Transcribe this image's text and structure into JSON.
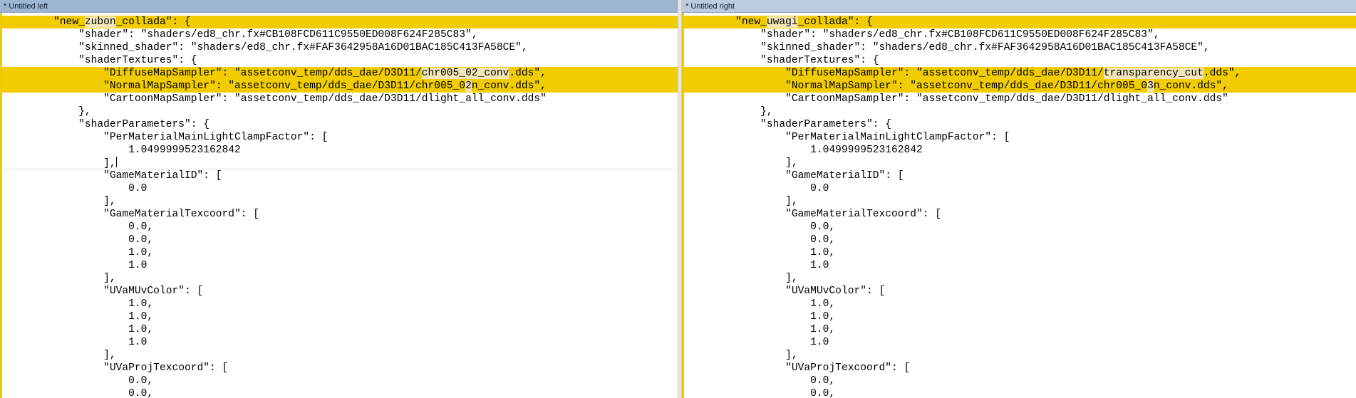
{
  "colors": {
    "changed_line": "#f0cc00",
    "changed_segment": "#f2e6b8",
    "left_titlebar": "#9fb6d3",
    "right_titlebar": "#bccbdf"
  },
  "left": {
    "title": "* Untitled left",
    "lines": [
      {
        "hl": true,
        "segs": [
          {
            "t": "        \"new_"
          },
          {
            "t": "zubon",
            "d": true
          },
          {
            "t": "_collada\": {"
          }
        ]
      },
      {
        "segs": [
          {
            "t": "            \"shader\": \"shaders/ed8_chr.fx#CB108FCD611C9550ED008F624F285C83\","
          }
        ]
      },
      {
        "segs": [
          {
            "t": "            \"skinned_shader\": \"shaders/ed8_chr.fx#FAF3642958A16D01BAC185C413FA58CE\","
          }
        ]
      },
      {
        "segs": [
          {
            "t": "            \"shaderTextures\": {"
          }
        ]
      },
      {
        "hl": true,
        "segs": [
          {
            "t": "                \"DiffuseMapSampler\": \"assetconv_temp/dds_dae/D3D11/"
          },
          {
            "t": "chr005_02_conv",
            "d": true
          },
          {
            "t": ".dds\","
          }
        ]
      },
      {
        "hl": true,
        "segs": [
          {
            "t": "                \"NormalMapSampler\": \"assetconv_temp/dds_dae/D3D11/chr005_0"
          },
          {
            "t": "2",
            "d": true
          },
          {
            "t": "n_conv.dds\","
          }
        ]
      },
      {
        "segs": [
          {
            "t": "                \"CartoonMapSampler\": \"assetconv_temp/dds_dae/D3D11/dlight_all_conv.dds\""
          }
        ]
      },
      {
        "segs": [
          {
            "t": "            },"
          }
        ]
      },
      {
        "segs": [
          {
            "t": "            \"shaderParameters\": {"
          }
        ]
      },
      {
        "segs": [
          {
            "t": "                \"PerMaterialMainLightClampFactor\": ["
          }
        ]
      },
      {
        "segs": [
          {
            "t": "                    1.0499999523162842"
          }
        ]
      },
      {
        "sep": true,
        "caret": true,
        "segs": [
          {
            "t": "                ],"
          }
        ]
      },
      {
        "segs": [
          {
            "t": "                \"GameMaterialID\": ["
          }
        ]
      },
      {
        "segs": [
          {
            "t": "                    0.0"
          }
        ]
      },
      {
        "segs": [
          {
            "t": "                ],"
          }
        ]
      },
      {
        "segs": [
          {
            "t": "                \"GameMaterialTexcoord\": ["
          }
        ]
      },
      {
        "segs": [
          {
            "t": "                    0.0,"
          }
        ]
      },
      {
        "segs": [
          {
            "t": "                    0.0,"
          }
        ]
      },
      {
        "segs": [
          {
            "t": "                    1.0,"
          }
        ]
      },
      {
        "segs": [
          {
            "t": "                    1.0"
          }
        ]
      },
      {
        "segs": [
          {
            "t": "                ],"
          }
        ]
      },
      {
        "segs": [
          {
            "t": "                \"UVaMUvColor\": ["
          }
        ]
      },
      {
        "segs": [
          {
            "t": "                    1.0,"
          }
        ]
      },
      {
        "segs": [
          {
            "t": "                    1.0,"
          }
        ]
      },
      {
        "segs": [
          {
            "t": "                    1.0,"
          }
        ]
      },
      {
        "segs": [
          {
            "t": "                    1.0"
          }
        ]
      },
      {
        "segs": [
          {
            "t": "                ],"
          }
        ]
      },
      {
        "segs": [
          {
            "t": "                \"UVaProjTexcoord\": ["
          }
        ]
      },
      {
        "segs": [
          {
            "t": "                    0.0,"
          }
        ]
      },
      {
        "segs": [
          {
            "t": "                    0.0,"
          }
        ]
      }
    ]
  },
  "right": {
    "title": "* Untitled right",
    "lines": [
      {
        "hl": true,
        "segs": [
          {
            "t": "        \"new_"
          },
          {
            "t": "uwagi",
            "d": true
          },
          {
            "t": "_collada\": {"
          }
        ]
      },
      {
        "segs": [
          {
            "t": "            \"shader\": \"shaders/ed8_chr.fx#CB108FCD611C9550ED008F624F285C83\","
          }
        ]
      },
      {
        "segs": [
          {
            "t": "            \"skinned_shader\": \"shaders/ed8_chr.fx#FAF3642958A16D01BAC185C413FA58CE\","
          }
        ]
      },
      {
        "segs": [
          {
            "t": "            \"shaderTextures\": {"
          }
        ]
      },
      {
        "hl": true,
        "segs": [
          {
            "t": "                \"DiffuseMapSampler\": \"assetconv_temp/dds_dae/D3D11/"
          },
          {
            "t": "transparency_cut",
            "d": true
          },
          {
            "t": ".dds\","
          }
        ]
      },
      {
        "hl": true,
        "segs": [
          {
            "t": "                \"NormalMapSampler\": \"assetconv_temp/dds_dae/D3D11/chr005_0"
          },
          {
            "t": "3",
            "d": true
          },
          {
            "t": "n_conv.dds\","
          }
        ]
      },
      {
        "segs": [
          {
            "t": "                \"CartoonMapSampler\": \"assetconv_temp/dds_dae/D3D11/dlight_all_conv.dds\""
          }
        ]
      },
      {
        "segs": [
          {
            "t": "            },"
          }
        ]
      },
      {
        "segs": [
          {
            "t": "            \"shaderParameters\": {"
          }
        ]
      },
      {
        "segs": [
          {
            "t": "                \"PerMaterialMainLightClampFactor\": ["
          }
        ]
      },
      {
        "segs": [
          {
            "t": "                    1.0499999523162842"
          }
        ]
      },
      {
        "segs": [
          {
            "t": "                ],"
          }
        ]
      },
      {
        "segs": [
          {
            "t": "                \"GameMaterialID\": ["
          }
        ]
      },
      {
        "segs": [
          {
            "t": "                    0.0"
          }
        ]
      },
      {
        "segs": [
          {
            "t": "                ],"
          }
        ]
      },
      {
        "segs": [
          {
            "t": "                \"GameMaterialTexcoord\": ["
          }
        ]
      },
      {
        "segs": [
          {
            "t": "                    0.0,"
          }
        ]
      },
      {
        "segs": [
          {
            "t": "                    0.0,"
          }
        ]
      },
      {
        "segs": [
          {
            "t": "                    1.0,"
          }
        ]
      },
      {
        "segs": [
          {
            "t": "                    1.0"
          }
        ]
      },
      {
        "segs": [
          {
            "t": "                ],"
          }
        ]
      },
      {
        "segs": [
          {
            "t": "                \"UVaMUvColor\": ["
          }
        ]
      },
      {
        "segs": [
          {
            "t": "                    1.0,"
          }
        ]
      },
      {
        "segs": [
          {
            "t": "                    1.0,"
          }
        ]
      },
      {
        "segs": [
          {
            "t": "                    1.0,"
          }
        ]
      },
      {
        "segs": [
          {
            "t": "                    1.0"
          }
        ]
      },
      {
        "segs": [
          {
            "t": "                ],"
          }
        ]
      },
      {
        "segs": [
          {
            "t": "                \"UVaProjTexcoord\": ["
          }
        ]
      },
      {
        "segs": [
          {
            "t": "                    0.0,"
          }
        ]
      },
      {
        "segs": [
          {
            "t": "                    0.0,"
          }
        ]
      }
    ]
  }
}
